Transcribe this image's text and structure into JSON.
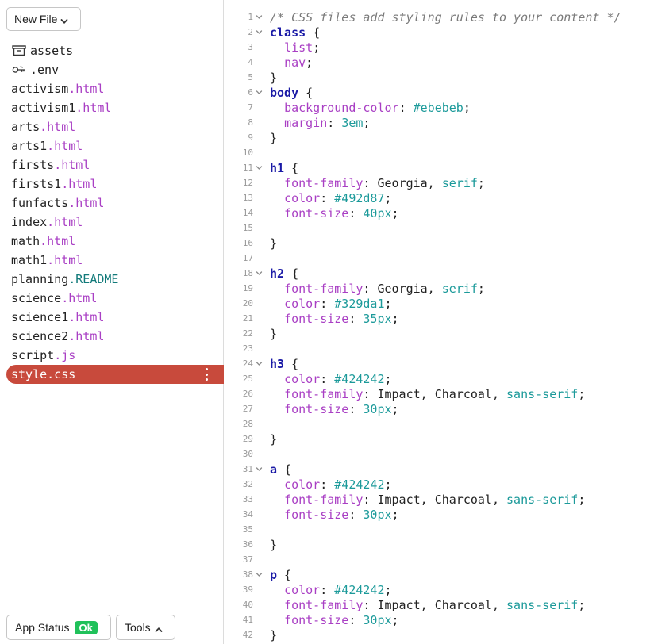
{
  "sidebar": {
    "new_file_label": "New File",
    "files": [
      {
        "name": "assets",
        "ext": "",
        "ext_class": "",
        "icon": "folder-icon"
      },
      {
        "name": ".env",
        "ext": "",
        "ext_class": "",
        "icon": "key-icon"
      },
      {
        "name": "activism",
        "ext": ".html",
        "ext_class": "html",
        "icon": ""
      },
      {
        "name": "activism1",
        "ext": ".html",
        "ext_class": "html",
        "icon": ""
      },
      {
        "name": "arts",
        "ext": ".html",
        "ext_class": "html",
        "icon": ""
      },
      {
        "name": "arts1",
        "ext": ".html",
        "ext_class": "html",
        "icon": ""
      },
      {
        "name": "firsts",
        "ext": ".html",
        "ext_class": "html",
        "icon": ""
      },
      {
        "name": "firsts1",
        "ext": ".html",
        "ext_class": "html",
        "icon": ""
      },
      {
        "name": "funfacts",
        "ext": ".html",
        "ext_class": "html",
        "icon": ""
      },
      {
        "name": "index",
        "ext": ".html",
        "ext_class": "html",
        "icon": ""
      },
      {
        "name": "math",
        "ext": ".html",
        "ext_class": "html",
        "icon": ""
      },
      {
        "name": "math1",
        "ext": ".html",
        "ext_class": "html",
        "icon": ""
      },
      {
        "name": "planning",
        "ext": ".README",
        "ext_class": "readme",
        "icon": ""
      },
      {
        "name": "science",
        "ext": ".html",
        "ext_class": "html",
        "icon": ""
      },
      {
        "name": "science1",
        "ext": ".html",
        "ext_class": "html",
        "icon": ""
      },
      {
        "name": "science2",
        "ext": ".html",
        "ext_class": "html",
        "icon": ""
      },
      {
        "name": "script",
        "ext": ".js",
        "ext_class": "js",
        "icon": ""
      },
      {
        "name": "style.css",
        "ext": "",
        "ext_class": "",
        "icon": "",
        "active": true
      }
    ],
    "status_label": "App Status",
    "status_badge": "Ok",
    "tools_label": "Tools"
  },
  "editor": {
    "lines": [
      {
        "n": "1",
        "fold": true,
        "tokens": [
          [
            "c-comment",
            "/* CSS files add styling rules to your content */"
          ]
        ]
      },
      {
        "n": "2",
        "fold": true,
        "tokens": [
          [
            "c-sel",
            "class"
          ],
          [
            "c-punc",
            " {"
          ]
        ]
      },
      {
        "n": "3",
        "fold": false,
        "tokens": [
          [
            "c-punc",
            "  "
          ],
          [
            "c-prop",
            "list"
          ],
          [
            "c-punc",
            ";"
          ]
        ]
      },
      {
        "n": "4",
        "fold": false,
        "tokens": [
          [
            "c-punc",
            "  "
          ],
          [
            "c-prop",
            "nav"
          ],
          [
            "c-punc",
            ";"
          ]
        ]
      },
      {
        "n": "5",
        "fold": false,
        "tokens": [
          [
            "c-punc",
            "}"
          ]
        ]
      },
      {
        "n": "6",
        "fold": true,
        "tokens": [
          [
            "c-sel",
            "body"
          ],
          [
            "c-punc",
            " {"
          ]
        ]
      },
      {
        "n": "7",
        "fold": false,
        "tokens": [
          [
            "c-punc",
            "  "
          ],
          [
            "c-prop",
            "background-color"
          ],
          [
            "c-punc",
            ": "
          ],
          [
            "c-num",
            "#ebebeb"
          ],
          [
            "c-punc",
            ";"
          ]
        ]
      },
      {
        "n": "8",
        "fold": false,
        "tokens": [
          [
            "c-punc",
            "  "
          ],
          [
            "c-prop",
            "margin"
          ],
          [
            "c-punc",
            ": "
          ],
          [
            "c-num",
            "3em"
          ],
          [
            "c-punc",
            ";"
          ]
        ]
      },
      {
        "n": "9",
        "fold": false,
        "tokens": [
          [
            "c-punc",
            "}"
          ]
        ]
      },
      {
        "n": "10",
        "fold": false,
        "tokens": []
      },
      {
        "n": "11",
        "fold": true,
        "tokens": [
          [
            "c-sel",
            "h1"
          ],
          [
            "c-punc",
            " {"
          ]
        ]
      },
      {
        "n": "12",
        "fold": false,
        "tokens": [
          [
            "c-punc",
            "  "
          ],
          [
            "c-prop",
            "font-family"
          ],
          [
            "c-punc",
            ": Georgia, "
          ],
          [
            "c-kw",
            "serif"
          ],
          [
            "c-punc",
            ";"
          ]
        ]
      },
      {
        "n": "13",
        "fold": false,
        "tokens": [
          [
            "c-punc",
            "  "
          ],
          [
            "c-prop",
            "color"
          ],
          [
            "c-punc",
            ": "
          ],
          [
            "c-num",
            "#492d87"
          ],
          [
            "c-punc",
            ";"
          ]
        ]
      },
      {
        "n": "14",
        "fold": false,
        "tokens": [
          [
            "c-punc",
            "  "
          ],
          [
            "c-prop",
            "font-size"
          ],
          [
            "c-punc",
            ": "
          ],
          [
            "c-num",
            "40px"
          ],
          [
            "c-punc",
            ";"
          ]
        ]
      },
      {
        "n": "15",
        "fold": false,
        "tokens": []
      },
      {
        "n": "16",
        "fold": false,
        "tokens": [
          [
            "c-punc",
            "}"
          ]
        ]
      },
      {
        "n": "17",
        "fold": false,
        "tokens": []
      },
      {
        "n": "18",
        "fold": true,
        "tokens": [
          [
            "c-sel",
            "h2"
          ],
          [
            "c-punc",
            " {"
          ]
        ]
      },
      {
        "n": "19",
        "fold": false,
        "tokens": [
          [
            "c-punc",
            "  "
          ],
          [
            "c-prop",
            "font-family"
          ],
          [
            "c-punc",
            ": Georgia, "
          ],
          [
            "c-kw",
            "serif"
          ],
          [
            "c-punc",
            ";"
          ]
        ]
      },
      {
        "n": "20",
        "fold": false,
        "tokens": [
          [
            "c-punc",
            "  "
          ],
          [
            "c-prop",
            "color"
          ],
          [
            "c-punc",
            ": "
          ],
          [
            "c-num",
            "#329da1"
          ],
          [
            "c-punc",
            ";"
          ]
        ]
      },
      {
        "n": "21",
        "fold": false,
        "tokens": [
          [
            "c-punc",
            "  "
          ],
          [
            "c-prop",
            "font-size"
          ],
          [
            "c-punc",
            ": "
          ],
          [
            "c-num",
            "35px"
          ],
          [
            "c-punc",
            ";"
          ]
        ]
      },
      {
        "n": "22",
        "fold": false,
        "tokens": [
          [
            "c-punc",
            "}"
          ]
        ]
      },
      {
        "n": "23",
        "fold": false,
        "tokens": []
      },
      {
        "n": "24",
        "fold": true,
        "tokens": [
          [
            "c-sel",
            "h3"
          ],
          [
            "c-punc",
            " {"
          ]
        ]
      },
      {
        "n": "25",
        "fold": false,
        "tokens": [
          [
            "c-punc",
            "  "
          ],
          [
            "c-prop",
            "color"
          ],
          [
            "c-punc",
            ": "
          ],
          [
            "c-num",
            "#424242"
          ],
          [
            "c-punc",
            ";"
          ]
        ]
      },
      {
        "n": "26",
        "fold": false,
        "tokens": [
          [
            "c-punc",
            "  "
          ],
          [
            "c-prop",
            "font-family"
          ],
          [
            "c-punc",
            ": Impact, Charcoal, "
          ],
          [
            "c-kw",
            "sans-serif"
          ],
          [
            "c-punc",
            ";"
          ]
        ]
      },
      {
        "n": "27",
        "fold": false,
        "tokens": [
          [
            "c-punc",
            "  "
          ],
          [
            "c-prop",
            "font-size"
          ],
          [
            "c-punc",
            ": "
          ],
          [
            "c-num",
            "30px"
          ],
          [
            "c-punc",
            ";"
          ]
        ]
      },
      {
        "n": "28",
        "fold": false,
        "tokens": []
      },
      {
        "n": "29",
        "fold": false,
        "tokens": [
          [
            "c-punc",
            "}"
          ]
        ]
      },
      {
        "n": "30",
        "fold": false,
        "tokens": []
      },
      {
        "n": "31",
        "fold": true,
        "tokens": [
          [
            "c-sel",
            "a"
          ],
          [
            "c-punc",
            " {"
          ]
        ]
      },
      {
        "n": "32",
        "fold": false,
        "tokens": [
          [
            "c-punc",
            "  "
          ],
          [
            "c-prop",
            "color"
          ],
          [
            "c-punc",
            ": "
          ],
          [
            "c-num",
            "#424242"
          ],
          [
            "c-punc",
            ";"
          ]
        ]
      },
      {
        "n": "33",
        "fold": false,
        "tokens": [
          [
            "c-punc",
            "  "
          ],
          [
            "c-prop",
            "font-family"
          ],
          [
            "c-punc",
            ": Impact, Charcoal, "
          ],
          [
            "c-kw",
            "sans-serif"
          ],
          [
            "c-punc",
            ";"
          ]
        ]
      },
      {
        "n": "34",
        "fold": false,
        "tokens": [
          [
            "c-punc",
            "  "
          ],
          [
            "c-prop",
            "font-size"
          ],
          [
            "c-punc",
            ": "
          ],
          [
            "c-num",
            "30px"
          ],
          [
            "c-punc",
            ";"
          ]
        ]
      },
      {
        "n": "35",
        "fold": false,
        "tokens": []
      },
      {
        "n": "36",
        "fold": false,
        "tokens": [
          [
            "c-punc",
            "}"
          ]
        ]
      },
      {
        "n": "37",
        "fold": false,
        "tokens": []
      },
      {
        "n": "38",
        "fold": true,
        "tokens": [
          [
            "c-sel",
            "p"
          ],
          [
            "c-punc",
            " {"
          ]
        ]
      },
      {
        "n": "39",
        "fold": false,
        "tokens": [
          [
            "c-punc",
            "  "
          ],
          [
            "c-prop",
            "color"
          ],
          [
            "c-punc",
            ": "
          ],
          [
            "c-num",
            "#424242"
          ],
          [
            "c-punc",
            ";"
          ]
        ]
      },
      {
        "n": "40",
        "fold": false,
        "tokens": [
          [
            "c-punc",
            "  "
          ],
          [
            "c-prop",
            "font-family"
          ],
          [
            "c-punc",
            ": Impact, Charcoal, "
          ],
          [
            "c-kw",
            "sans-serif"
          ],
          [
            "c-punc",
            ";"
          ]
        ]
      },
      {
        "n": "41",
        "fold": false,
        "tokens": [
          [
            "c-punc",
            "  "
          ],
          [
            "c-prop",
            "font-size"
          ],
          [
            "c-punc",
            ": "
          ],
          [
            "c-num",
            "30px"
          ],
          [
            "c-punc",
            ";"
          ]
        ]
      },
      {
        "n": "42",
        "fold": false,
        "tokens": [
          [
            "c-punc",
            "}"
          ]
        ]
      }
    ]
  },
  "colors": {
    "active_file_bg": "#c84a3c",
    "status_ok_badge": "#20c15a",
    "html_ext": "#a93fc4",
    "readme_ext": "#127a7a",
    "selector": "#1a1aa6",
    "value": "#1c9a9a"
  }
}
